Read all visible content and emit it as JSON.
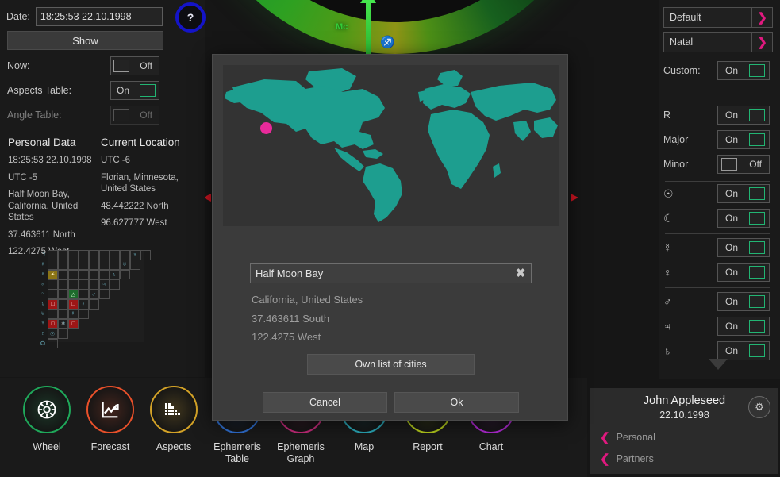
{
  "background_chart": {
    "mc_label": "Mc",
    "sign_glyph": "♐"
  },
  "left_panel": {
    "date_label": "Date:",
    "date_value": "18:25:53 22.10.1998",
    "help_label": "?",
    "show_label": "Show",
    "toggles": [
      {
        "label": "Now:",
        "state": "Off",
        "on": false,
        "disabled": false
      },
      {
        "label": "Aspects Table:",
        "state": "On",
        "on": true,
        "disabled": false
      },
      {
        "label": "Angle Table:",
        "state": "Off",
        "on": false,
        "disabled": true
      }
    ],
    "personal_data": {
      "heading": "Personal Data",
      "lines": [
        "18:25:53 22.10.1998",
        "UTC -5",
        "Half Moon Bay, California, United States",
        "37.463611 North",
        "122.4275 West"
      ]
    },
    "current_location": {
      "heading": "Current Location",
      "lines": [
        "UTC -6",
        "Florian, Minnesota, United States",
        "48.442222 North",
        "96.627777 West"
      ]
    },
    "aspect_grid": {
      "row_glyphs": [
        "☽",
        "☿",
        "♀",
        "♂",
        "♃",
        "♄",
        "♅",
        "♆",
        "♇",
        "☊"
      ],
      "col_glyphs": [
        "☉",
        "☽",
        "☿",
        "♀",
        "♂",
        "♃",
        "♄",
        "♅",
        "♆"
      ],
      "marks": [
        {
          "row": 2,
          "col": 0,
          "symbol": "⚹",
          "kind": "olive"
        },
        {
          "row": 4,
          "col": 2,
          "symbol": "△",
          "kind": "green"
        },
        {
          "row": 5,
          "col": 0,
          "symbol": "□",
          "kind": "red"
        },
        {
          "row": 5,
          "col": 2,
          "symbol": "□",
          "kind": "red"
        },
        {
          "row": 7,
          "col": 0,
          "symbol": "□",
          "kind": "red"
        },
        {
          "row": 7,
          "col": 1,
          "symbol": "✶",
          "kind": "plain"
        },
        {
          "row": 7,
          "col": 2,
          "symbol": "□",
          "kind": "red"
        },
        {
          "row": 7,
          "col": 4,
          "symbol": "□",
          "kind": "red"
        },
        {
          "row": 8,
          "col": 3,
          "symbol": "□",
          "kind": "red"
        },
        {
          "row": 8,
          "col": 6,
          "symbol": "△",
          "kind": "green"
        }
      ]
    }
  },
  "bottom_nav": [
    {
      "label": "Wheel",
      "icon": "wheel-icon",
      "color": "#1fa85a"
    },
    {
      "label": "Forecast",
      "icon": "trend-up-icon",
      "color": "#e8502a"
    },
    {
      "label": "Aspects",
      "icon": "bar-steps-icon",
      "color": "#d3a227"
    },
    {
      "label": "Ephemeris\nTable",
      "icon": "table-icon",
      "color": "#2f6fd0"
    },
    {
      "label": "Ephemeris\nGraph",
      "icon": "graph-icon",
      "color": "#c42b7a"
    },
    {
      "label": "Map",
      "icon": "map-icon",
      "color": "#2aa8b8"
    },
    {
      "label": "Report",
      "icon": "report-icon",
      "color": "#b5cc1c"
    },
    {
      "label": "Chart",
      "icon": "chart-icon",
      "color": "#b12ad4"
    }
  ],
  "right_panel": {
    "selects": [
      {
        "value": "Default",
        "icon": "chevron-right-icon"
      },
      {
        "value": "Natal",
        "icon": "chevron-right-icon"
      }
    ],
    "custom": {
      "label": "Custom:",
      "state": "On",
      "on": true
    },
    "options": [
      {
        "label": "R",
        "state": "On",
        "on": true,
        "type": "text"
      },
      {
        "label": "Major",
        "state": "On",
        "on": true,
        "type": "text"
      },
      {
        "label": "Minor",
        "state": "Off",
        "on": false,
        "type": "text"
      }
    ],
    "planets": [
      {
        "glyph": "☉",
        "name": "sun",
        "state": "On",
        "on": true
      },
      {
        "glyph": "☾",
        "name": "moon",
        "state": "On",
        "on": true
      },
      {
        "glyph": "☿",
        "name": "mercury",
        "state": "On",
        "on": true
      },
      {
        "glyph": "♀",
        "name": "venus",
        "state": "On",
        "on": true
      },
      {
        "glyph": "♂",
        "name": "mars",
        "state": "On",
        "on": true
      },
      {
        "glyph": "♃",
        "name": "jupiter",
        "state": "On",
        "on": true
      },
      {
        "glyph": "♄",
        "name": "saturn",
        "state": "On",
        "on": true
      }
    ],
    "scroll_icon": "chevron-down-icon"
  },
  "profile": {
    "name": "John Appleseed",
    "date": "22.10.1998",
    "gear_icon": "gear-icon",
    "rows": [
      {
        "label": "Personal",
        "icon": "chevron-left-icon"
      },
      {
        "label": "Partners",
        "icon": "chevron-left-icon"
      }
    ]
  },
  "modal": {
    "map_pin_color": "#e82a9a",
    "map_land_color": "#1d9e8f",
    "city_value": "Half Moon Bay",
    "clear_icon": "close-icon",
    "detail_lines": [
      "California, United States",
      "37.463611 South",
      "122.4275 West"
    ],
    "own_list_label": "Own list of cities",
    "cancel_label": "Cancel",
    "ok_label": "Ok"
  }
}
